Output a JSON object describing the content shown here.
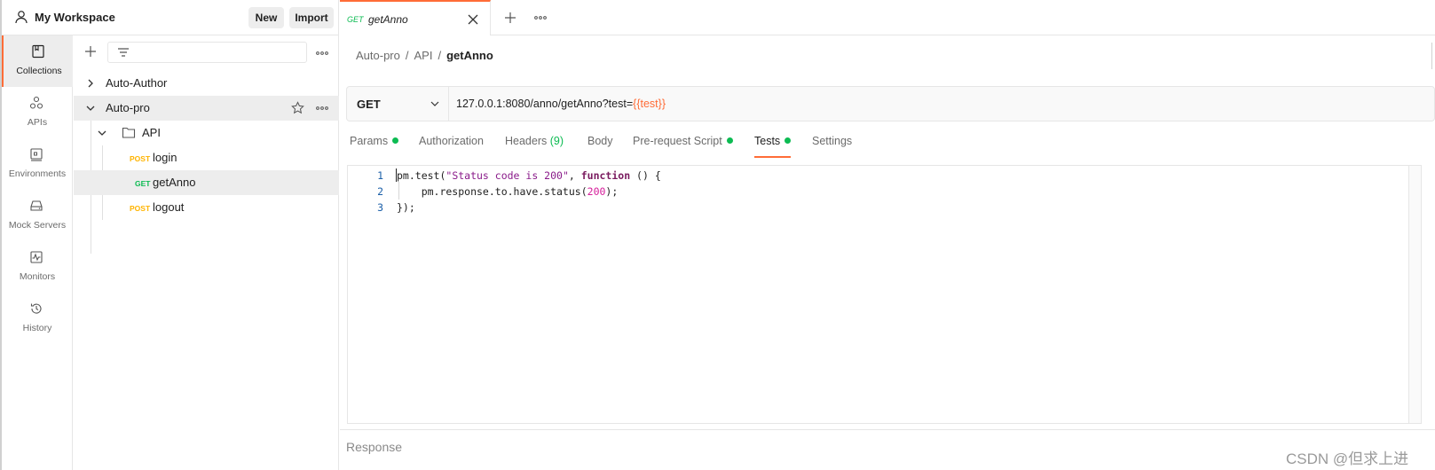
{
  "workspace": {
    "title": "My Workspace",
    "new_label": "New",
    "import_label": "Import"
  },
  "rail": {
    "items": [
      {
        "label": "Collections",
        "icon": "collections-icon"
      },
      {
        "label": "APIs",
        "icon": "apis-icon"
      },
      {
        "label": "Environments",
        "icon": "environments-icon"
      },
      {
        "label": "Mock Servers",
        "icon": "mock-servers-icon"
      },
      {
        "label": "Monitors",
        "icon": "monitors-icon"
      },
      {
        "label": "History",
        "icon": "history-icon"
      }
    ]
  },
  "tree": {
    "collections": [
      {
        "name": "Auto-Author"
      },
      {
        "name": "Auto-pro"
      }
    ],
    "folder": "API",
    "requests": [
      {
        "method": "POST",
        "name": "login"
      },
      {
        "method": "GET",
        "name": "getAnno"
      },
      {
        "method": "POST",
        "name": "logout"
      }
    ]
  },
  "tab": {
    "method": "GET",
    "name": "getAnno"
  },
  "breadcrumb": {
    "items": [
      "Auto-pro",
      "/",
      "API",
      "/"
    ],
    "current": "getAnno"
  },
  "request": {
    "method": "GET",
    "url_prefix": "127.0.0.1:8080/anno/getAnno?test=",
    "url_var": "{{test}}"
  },
  "request_tabs": [
    {
      "label": "Params",
      "dot": true
    },
    {
      "label": "Authorization",
      "dot": false
    },
    {
      "label": "Headers",
      "count": "(9)",
      "dot": false
    },
    {
      "label": "Body",
      "dot": false
    },
    {
      "label": "Pre-request Script",
      "dot": true
    },
    {
      "label": "Tests",
      "dot": true,
      "active": true
    },
    {
      "label": "Settings",
      "dot": false
    }
  ],
  "editor": {
    "line_numbers": [
      "1",
      "2",
      "3"
    ],
    "line1": {
      "a": "pm.test(",
      "b": "\"Status code is 200\"",
      "c": ", ",
      "d": "function",
      "e": " () {"
    },
    "line2": {
      "a": "    pm.response.to.have.status(",
      "b": "200",
      "c": ");"
    },
    "line3": "});"
  },
  "response": {
    "label": "Response"
  },
  "watermark": "CSDN @但求上进",
  "colors": {
    "accent": "#ff6c37",
    "get": "#0cbb52",
    "post": "#ffb400"
  }
}
